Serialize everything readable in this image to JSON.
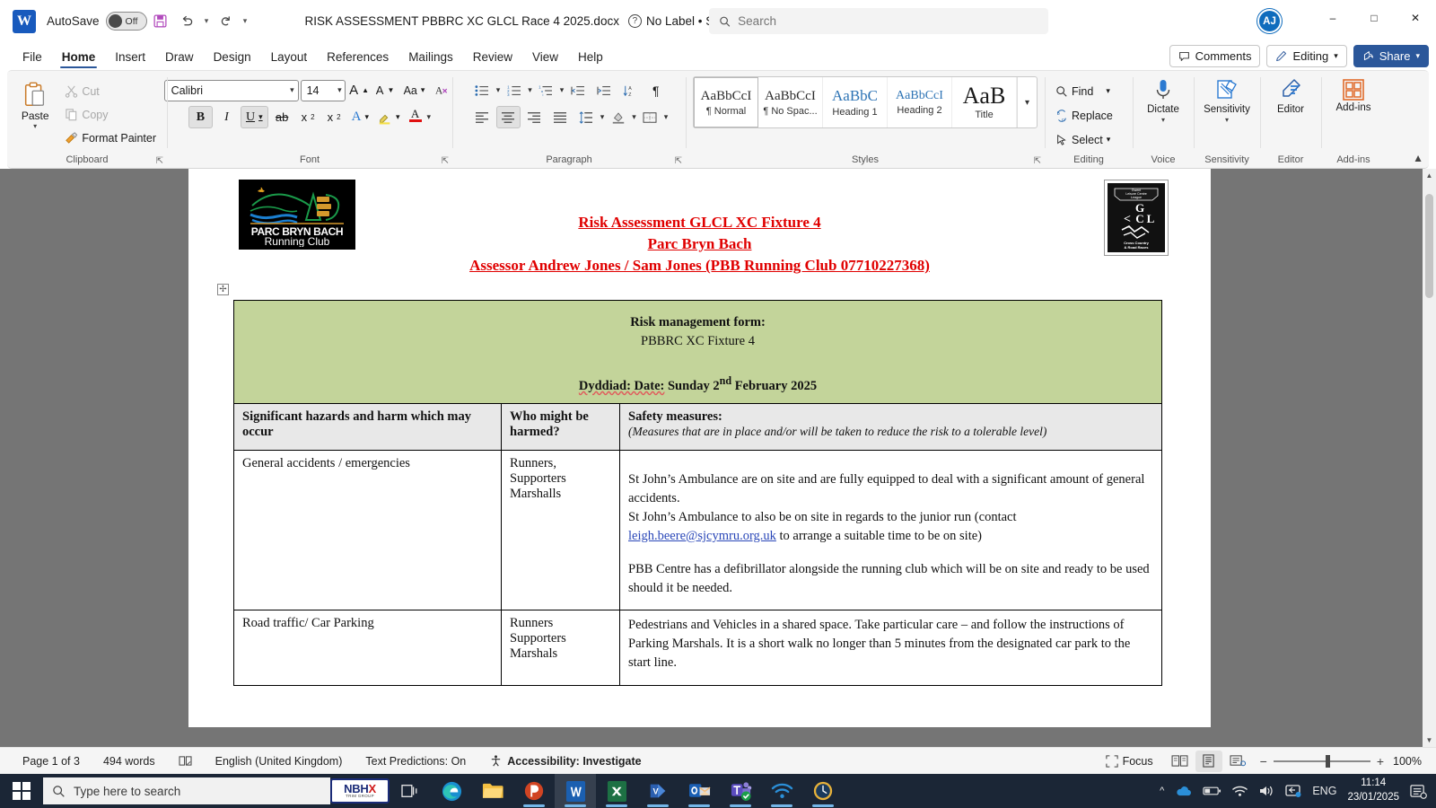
{
  "titlebar": {
    "app_icon": "word-icon",
    "autosave_label": "AutoSave",
    "autosave_state": "Off",
    "save_icon": "save-icon",
    "undo_icon": "undo-icon",
    "redo_icon": "redo-icon",
    "customize_icon": "customize-quick-access-icon",
    "document_title": "RISK ASSESSMENT PBBRC XC GLCL Race 4 2025.docx",
    "sensitivity_label": "No Label • Saved to this PC",
    "search_placeholder": "Search",
    "avatar_initials": "AJ",
    "minimize": "minimize-icon",
    "maximize": "maximize-icon",
    "close": "close-icon"
  },
  "tabs": [
    {
      "label": "File",
      "active": false
    },
    {
      "label": "Home",
      "active": true
    },
    {
      "label": "Insert",
      "active": false
    },
    {
      "label": "Draw",
      "active": false
    },
    {
      "label": "Design",
      "active": false
    },
    {
      "label": "Layout",
      "active": false
    },
    {
      "label": "References",
      "active": false
    },
    {
      "label": "Mailings",
      "active": false
    },
    {
      "label": "Review",
      "active": false
    },
    {
      "label": "View",
      "active": false
    },
    {
      "label": "Help",
      "active": false
    }
  ],
  "tabbar_right": {
    "comments": "Comments",
    "editing": "Editing",
    "share": "Share"
  },
  "ribbon": {
    "clipboard": {
      "group_label": "Clipboard",
      "paste": "Paste",
      "cut": "Cut",
      "copy": "Copy",
      "format_painter": "Format Painter"
    },
    "font": {
      "group_label": "Font",
      "font_name": "Calibri",
      "font_size": "14",
      "grow_font": "A",
      "shrink_font": "A",
      "change_case": "Aa",
      "clear_formatting": "clear-formatting-icon",
      "bold": "B",
      "italic": "I",
      "underline": "U",
      "strikethrough": "ab",
      "subscript": "x",
      "superscript": "x",
      "text_effects": "A",
      "highlight": "highlight-icon",
      "font_color": "A"
    },
    "paragraph": {
      "group_label": "Paragraph",
      "bullets": "bullets-icon",
      "numbering": "numbering-icon",
      "multilevel": "multilevel-list-icon",
      "decrease_indent": "decrease-indent-icon",
      "increase_indent": "increase-indent-icon",
      "sort": "sort-icon",
      "show_marks": "show-formatting-marks-icon",
      "align_left": "align-left-icon",
      "align_center": "align-center-icon",
      "align_right": "align-right-icon",
      "justify": "justify-icon",
      "line_spacing": "line-spacing-icon",
      "shading": "shading-icon",
      "borders": "borders-icon"
    },
    "styles": {
      "group_label": "Styles",
      "items": [
        {
          "preview": "AaBbCcI",
          "name": "Normal",
          "mark": "¶",
          "selected": true
        },
        {
          "preview": "AaBbCcI",
          "name": "No Spac...",
          "mark": "¶",
          "selected": false
        },
        {
          "preview": "AaBbC",
          "name": "Heading 1",
          "mark": "",
          "selected": false
        },
        {
          "preview": "AaBbCcI",
          "name": "Heading 2",
          "mark": "",
          "selected": false
        },
        {
          "preview": "AaB",
          "name": "Title",
          "mark": "",
          "selected": false
        }
      ],
      "more": "more-styles-icon"
    },
    "editing": {
      "group_label": "Editing",
      "find": "Find",
      "replace": "Replace",
      "select": "Select"
    },
    "voice": {
      "group_label": "Voice",
      "dictate": "Dictate"
    },
    "sensitivity": {
      "group_label": "Sensitivity",
      "label": "Sensitivity"
    },
    "editor": {
      "group_label": "Editor",
      "label": "Editor"
    },
    "addins": {
      "group_label": "Add-ins",
      "label": "Add-ins"
    },
    "collapse": "collapse-ribbon-icon"
  },
  "document": {
    "logo_left": {
      "name": "parc-bryn-bach-running-club-logo",
      "line1": "PARC BRYN BACH",
      "line2": "Running Club"
    },
    "logo_right": {
      "name": "gwent-leisure-centre-league-logo",
      "top": "Gwent Leisure Centre League",
      "mid": "GCL",
      "bottom": "Cross Country & Road Races"
    },
    "headings": [
      "Risk Assessment GLCL XC Fixture 4",
      "Parc Bryn Bach",
      "Assessor Andrew Jones / Sam Jones (PBB Running Club 07710227368)"
    ],
    "table_banner": {
      "line1": "Risk management form:",
      "line2": "PBBRC XC Fixture 4",
      "date_label": "Dyddiad: Date:",
      "date_value": "Sunday 2",
      "date_sup": "nd",
      "date_rest": "February 2025"
    },
    "table_headers": {
      "col1": "Significant hazards and harm which may occur",
      "col2": "Who might be harmed?",
      "col3_title": "Safety measures:",
      "col3_sub": "(Measures that are in place and/or will be taken to reduce the risk to a tolerable level)"
    },
    "rows": [
      {
        "hazard": "General accidents / emergencies",
        "who": "Runners,\nSupporters\nMarshalls",
        "measures_p1_a": "St John’s Ambulance are on site and are fully equipped to deal with a significant amount of general accidents.",
        "measures_p1_b": "St John’s Ambulance to also be on site in regards to the junior run (contact ",
        "measures_link": "leigh.beere@sjcymru.org.uk",
        "measures_p1_c": " to arrange a suitable time to be on site)",
        "measures_p2": "PBB Centre has a defibrillator alongside the running club which will be on site and ready to be used should it be needed."
      },
      {
        "hazard": "Road traffic/ Car Parking",
        "who": "Runners\nSupporters\nMarshals",
        "measures_p1_a": "Pedestrians and Vehicles in a shared space.  Take particular care – and follow the instructions of Parking Marshals. It is a short walk no longer than 5 minutes from the designated car park to the start line.",
        "measures_p1_b": "",
        "measures_link": "",
        "measures_p1_c": "",
        "measures_p2": ""
      }
    ]
  },
  "statusbar": {
    "page": "Page 1 of 3",
    "words": "494 words",
    "proofing_icon": "proofing-errors-icon",
    "language": "English (United Kingdom)",
    "text_predictions": "Text Predictions: On",
    "accessibility": "Accessibility: Investigate",
    "focus": "Focus",
    "view_read": "read-mode-icon",
    "view_print": "print-layout-icon",
    "view_web": "web-layout-icon",
    "zoom_out": "−",
    "zoom_in": "+",
    "zoom_level": "100%"
  },
  "taskbar": {
    "start": "start-icon",
    "search_placeholder": "Type here to search",
    "nbhx": {
      "top": "NBHX",
      "bottom": "TRIM GROUP"
    },
    "task_view": "task-view-icon",
    "apps": [
      {
        "name": "edge-icon",
        "running": false,
        "active": false
      },
      {
        "name": "file-explorer-icon",
        "running": false,
        "active": false
      },
      {
        "name": "powerpoint-icon",
        "running": true,
        "active": false
      },
      {
        "name": "word-icon",
        "running": true,
        "active": true
      },
      {
        "name": "excel-icon",
        "running": true,
        "active": false
      },
      {
        "name": "visio-icon",
        "running": true,
        "active": false
      },
      {
        "name": "outlook-icon",
        "running": true,
        "active": false
      },
      {
        "name": "teams-icon",
        "running": true,
        "active": false
      },
      {
        "name": "wifi-app-icon",
        "running": true,
        "active": false
      },
      {
        "name": "clock-app-icon",
        "running": true,
        "active": false
      }
    ],
    "tray": {
      "chevron": "show-hidden-icons",
      "onedrive": "onedrive-icon",
      "battery": "battery-icon",
      "wifi": "wifi-icon",
      "volume": "volume-icon",
      "display": "display-settings-icon",
      "language": "ENG",
      "time": "11:14",
      "date": "23/01/2025",
      "notifications": "notification-center-icon"
    }
  },
  "colors": {
    "word_blue": "#185ABD",
    "accent": "#2b579a",
    "table_green": "#c3d49a",
    "heading_red": "#e00000",
    "link_blue": "#2a47b8"
  }
}
